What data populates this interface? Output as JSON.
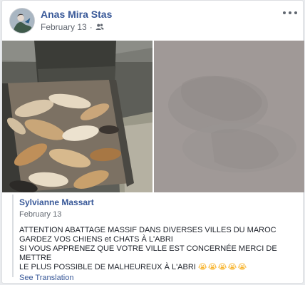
{
  "post": {
    "author": "Anas Mira Stas",
    "date": "February 13",
    "separator": "·",
    "audience_icon": "friends-icon",
    "more_icon": "more-options-icon"
  },
  "photos": [
    {
      "name": "photo-truck-animals"
    },
    {
      "name": "photo-grey-blurred"
    }
  ],
  "shared": {
    "author": "Sylvianne Massart",
    "date": "February 13",
    "text": "ATTENTION ABATTAGE MASSIF DANS DIVERSES VILLES DU MAROC\nGARDEZ VOS CHIENS et CHATS À L'ABRI\nSI VOUS APPRENEZ QUE VOTRE VILLE EST CONCERNÉE MERCI DE METTRE\nLE PLUS POSSIBLE DE MALHEUREUX À L'ABRI",
    "emojis": "😭😭😭😭😭",
    "see_translation": "See Translation"
  },
  "colors": {
    "link": "#385898",
    "meta": "#616770",
    "border": "#dddfe2"
  }
}
